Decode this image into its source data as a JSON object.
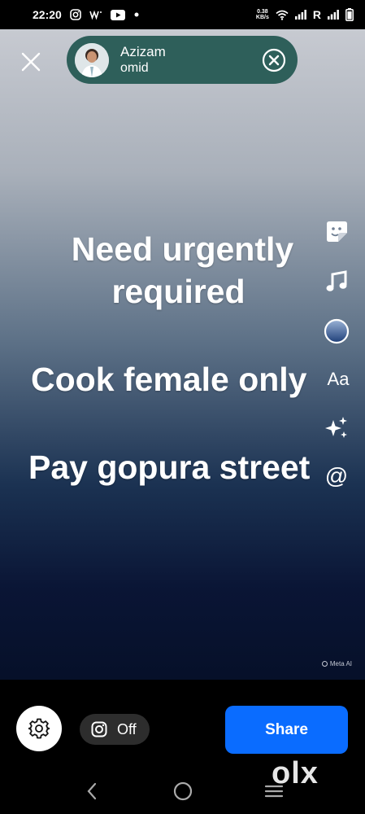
{
  "status_bar": {
    "time": "22:20",
    "speed_value": "0.38",
    "speed_unit": "KB/s",
    "sim_label": "R"
  },
  "story": {
    "user": {
      "name": "Azizam",
      "subtitle": "omid"
    },
    "lines": [
      "Need urgently",
      "required",
      "Cook female only",
      "Pay gopura street"
    ],
    "tools": {
      "text_tool": "Aa",
      "mention_tool": "@"
    },
    "watermark": "Meta AI"
  },
  "bottom": {
    "instagram_toggle": "Off",
    "share_label": "Share",
    "olx_watermark": "olx"
  },
  "colors": {
    "share_blue": "#0a6cff",
    "pill_green": "#2e5f5a"
  }
}
